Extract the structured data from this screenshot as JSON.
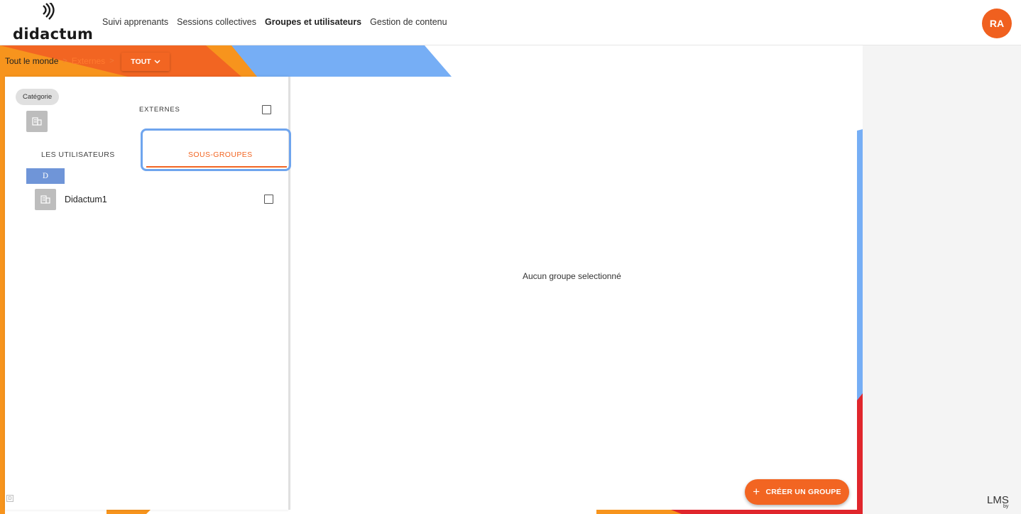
{
  "header": {
    "logo_text": "didactum",
    "nav": [
      {
        "label": "Suivi apprenants",
        "active": false
      },
      {
        "label": "Sessions collectives",
        "active": false
      },
      {
        "label": "Groupes et utilisateurs",
        "active": true
      },
      {
        "label": "Gestion de contenu",
        "active": false
      }
    ],
    "avatar_initials": "RA"
  },
  "breadcrumb": {
    "root": "Tout le monde",
    "separator": ">",
    "current": "Externes",
    "filter_button": "TOUT"
  },
  "left_panel": {
    "chip_label": "Catégorie",
    "group_name": "EXTERNES",
    "tabs": {
      "users": "LES UTILISATEURS",
      "subgroups": "SOUS-GROUPES"
    },
    "letter_header": "D",
    "items": [
      {
        "label": "Didactum1"
      }
    ],
    "footer_badge": "D"
  },
  "main_panel": {
    "empty_message": "Aucun groupe selectionné",
    "create_button": "CRÉER UN GROUPE"
  },
  "branding": {
    "lms": "LMS",
    "by": "by"
  },
  "colors": {
    "accent": "#f26522",
    "orange_deco": "#f7941d",
    "blue_deco": "#76aef5",
    "red_deco": "#e0262c",
    "focus": "#6fa5ee"
  }
}
